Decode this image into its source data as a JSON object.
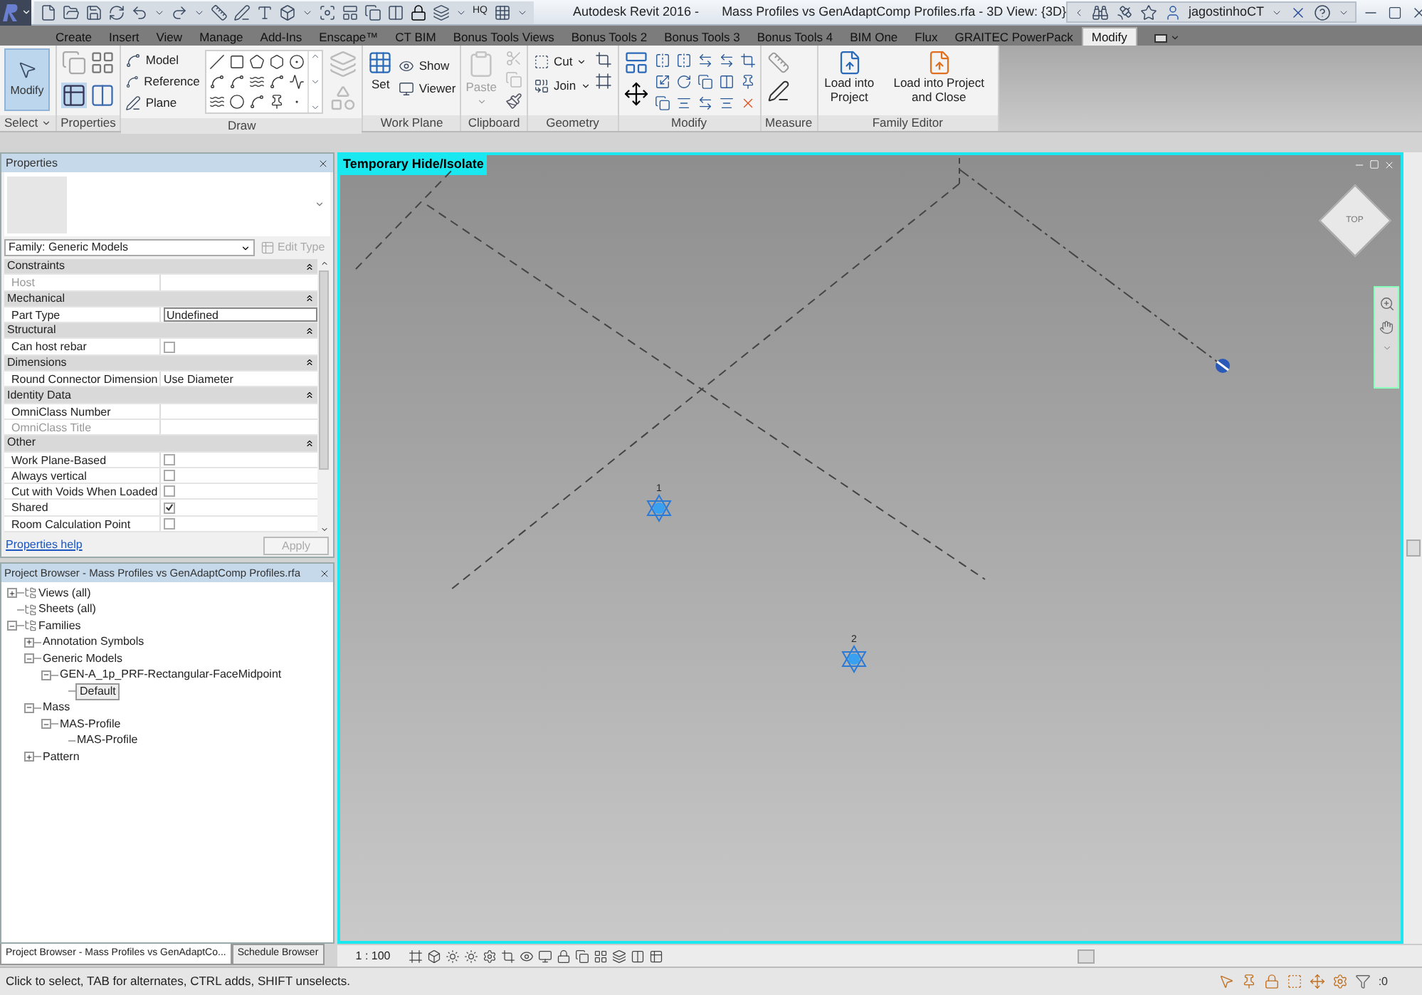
{
  "title_bar": {
    "qat_label": "HQ",
    "app": "Autodesk Revit 2016 -",
    "document": "Mass Profiles vs GenAdaptComp Profiles.rfa - 3D View: {3D}",
    "user": "jagostinhoCT"
  },
  "ribbon_tabs": [
    {
      "label": "Create",
      "selected": false
    },
    {
      "label": "Insert",
      "selected": false
    },
    {
      "label": "View",
      "selected": false
    },
    {
      "label": "Manage",
      "selected": false
    },
    {
      "label": "Add-Ins",
      "selected": false
    },
    {
      "label": "Enscape™",
      "selected": false
    },
    {
      "label": "CT BIM",
      "selected": false
    },
    {
      "label": "Bonus Tools Views",
      "selected": false
    },
    {
      "label": "Bonus Tools 2",
      "selected": false
    },
    {
      "label": "Bonus Tools 3",
      "selected": false
    },
    {
      "label": "Bonus Tools 4",
      "selected": false
    },
    {
      "label": "BIM One",
      "selected": false
    },
    {
      "label": "Flux",
      "selected": false
    },
    {
      "label": "GRAITEC PowerPack",
      "selected": false
    },
    {
      "label": "Modify",
      "selected": true
    }
  ],
  "ribbon_panels": [
    {
      "kind": "select",
      "title": "Select",
      "button": {
        "label": "Modify",
        "selected": true
      }
    },
    {
      "kind": "properties",
      "title": "Properties"
    },
    {
      "kind": "draw",
      "title": "Draw",
      "items": [
        "Model",
        "Reference",
        "Plane"
      ]
    },
    {
      "kind": "workplane",
      "title": "Work Plane",
      "set": "Set",
      "items": [
        "Show",
        "Viewer"
      ]
    },
    {
      "kind": "clipboard",
      "title": "Clipboard",
      "paste": {
        "label": "Paste",
        "disabled": true
      }
    },
    {
      "kind": "geometry",
      "title": "Geometry",
      "items": [
        "Cut",
        "Join"
      ]
    },
    {
      "kind": "modify",
      "title": "Modify"
    },
    {
      "kind": "measure",
      "title": "Measure"
    },
    {
      "kind": "family_editor",
      "title": "Family Editor",
      "items": [
        "Load into Project",
        "Load into Project and Close"
      ]
    }
  ],
  "properties": {
    "title": "Properties",
    "type_selector": "Family: Generic Models",
    "edit_type": {
      "label": "Edit Type",
      "disabled": true
    },
    "groups": [
      {
        "name": "Constraints",
        "rows": [
          {
            "kind": "text",
            "label": "Host",
            "value": "",
            "disabled": true
          }
        ]
      },
      {
        "name": "Mechanical",
        "rows": [
          {
            "kind": "field",
            "label": "Part Type",
            "value": "Undefined",
            "disabled": false
          }
        ]
      },
      {
        "name": "Structural",
        "rows": [
          {
            "kind": "checkbox",
            "label": "Can host rebar",
            "checked": false,
            "disabled": false
          }
        ]
      },
      {
        "name": "Dimensions",
        "rows": [
          {
            "kind": "text",
            "label": "Round Connector Dimension",
            "value": "Use Diameter",
            "disabled": false
          }
        ]
      },
      {
        "name": "Identity Data",
        "rows": [
          {
            "kind": "text",
            "label": "OmniClass Number",
            "value": "",
            "disabled": false
          },
          {
            "kind": "text",
            "label": "OmniClass Title",
            "value": "",
            "disabled": true
          }
        ]
      },
      {
        "name": "Other",
        "rows": [
          {
            "kind": "checkbox",
            "label": "Work Plane-Based",
            "checked": false,
            "disabled": false
          },
          {
            "kind": "checkbox",
            "label": "Always vertical",
            "checked": false,
            "disabled": false
          },
          {
            "kind": "checkbox",
            "label": "Cut with Voids When Loaded",
            "checked": false,
            "disabled": false
          },
          {
            "kind": "checkbox",
            "label": "Shared",
            "checked": true,
            "disabled": false
          },
          {
            "kind": "checkbox",
            "label": "Room Calculation Point",
            "checked": false,
            "disabled": false
          }
        ]
      }
    ],
    "help_link": "Properties help",
    "apply": {
      "label": "Apply",
      "disabled": true
    }
  },
  "project_browser": {
    "title": "Project Browser - Mass Profiles vs GenAdaptComp Profiles.rfa",
    "tree": [
      {
        "label": "Views (all)",
        "expanded": false,
        "selected": false
      },
      {
        "label": "Sheets (all)",
        "selected": false
      },
      {
        "label": "Families",
        "expanded": true,
        "selected": false,
        "children": [
          {
            "label": "Annotation Symbols",
            "expanded": false,
            "selected": false
          },
          {
            "label": "Generic Models",
            "expanded": true,
            "selected": false,
            "children": [
              {
                "label": "GEN-A_1p_PRF-Rectangular-FaceMidpoint",
                "expanded": true,
                "selected": false,
                "children": [
                  {
                    "label": "Default",
                    "selected": true
                  }
                ]
              }
            ]
          },
          {
            "label": "Mass",
            "expanded": true,
            "selected": false,
            "children": [
              {
                "label": "MAS-Profile",
                "expanded": true,
                "selected": false,
                "children": [
                  {
                    "label": "MAS-Profile",
                    "selected": false
                  }
                ]
              }
            ]
          },
          {
            "label": "Pattern",
            "expanded": false,
            "selected": false
          }
        ]
      }
    ]
  },
  "browser_tabs": [
    {
      "label": "Project Browser - Mass Profiles vs GenAdaptCo...",
      "selected": true
    },
    {
      "label": "Schedule Browser",
      "selected": false
    }
  ],
  "viewport": {
    "label": "Temporary Hide/Isolate",
    "view_cube": "TOP",
    "points": [
      "1",
      "2"
    ]
  },
  "view_control_bar": {
    "scale": "1 : 100"
  },
  "status_bar": {
    "message": "Click to select, TAB for alternates, CTRL adds, SHIFT unselects.",
    "filter_count": ":0"
  }
}
